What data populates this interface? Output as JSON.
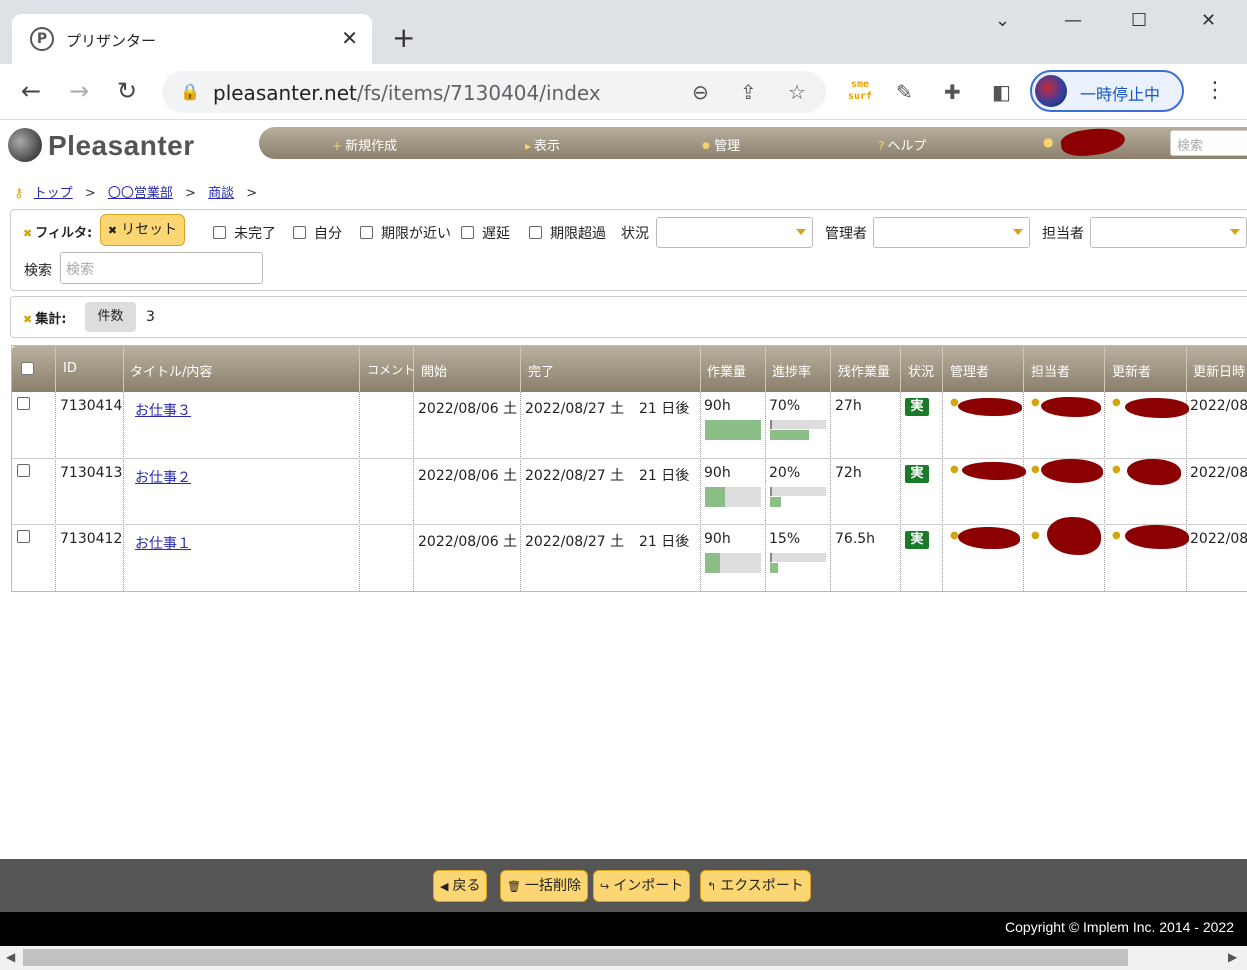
{
  "browser": {
    "tab_title": "プリザンター",
    "tab_favicon_letter": "P",
    "tab_close": "✕",
    "new_tab": "+",
    "url_host": "pleasanter.net",
    "url_path": "/fs/items/7130404/index",
    "profile_label": "一時停止中",
    "extension_label": "sme surf",
    "minimize": "—",
    "maximize": "☐",
    "close": "✕",
    "chevron": "⌄"
  },
  "app": {
    "logo": "Pleasanter",
    "menu": [
      {
        "icon": "+",
        "label": "新規作成"
      },
      {
        "icon": "▸",
        "label": "表示"
      },
      {
        "icon": "✹",
        "label": "管理"
      },
      {
        "icon": "?",
        "label": "ヘルプ"
      }
    ],
    "search_placeholder": "検索"
  },
  "breadcrumb": {
    "items": [
      "トップ",
      "〇〇営業部",
      "商談"
    ],
    "separator": ">"
  },
  "filter": {
    "label": "フィルタ:",
    "reset": "リセット",
    "checkboxes": [
      "未完了",
      "自分",
      "期限が近い",
      "遅延",
      "期限超過"
    ],
    "status_label": "状況",
    "manager_label": "管理者",
    "owner_label": "担当者",
    "search_label": "検索",
    "search_placeholder": "検索"
  },
  "summary": {
    "label": "集計:",
    "count_label": "件数",
    "count_value": "3"
  },
  "table": {
    "columns": [
      "ID",
      "タイトル/内容",
      "コメント",
      "開始",
      "完了",
      "作業量",
      "進捗率",
      "残作業量",
      "状況",
      "管理者",
      "担当者",
      "更新者",
      "更新日時"
    ],
    "rows": [
      {
        "id": "7130414",
        "title": "お仕事３",
        "start": "2022/08/06 土",
        "end": "2022/08/27 土",
        "due": "21 日後",
        "workload": "90h",
        "workload_fill": 1.0,
        "progress": "70%",
        "progress_fill": 0.7,
        "remaining": "27h",
        "status": "実",
        "updated": "2022/08"
      },
      {
        "id": "7130413",
        "title": "お仕事２",
        "start": "2022/08/06 土",
        "end": "2022/08/27 土",
        "due": "21 日後",
        "workload": "90h",
        "workload_fill": 0.35,
        "progress": "20%",
        "progress_fill": 0.2,
        "remaining": "72h",
        "status": "実",
        "updated": "2022/08"
      },
      {
        "id": "7130412",
        "title": "お仕事１",
        "start": "2022/08/06 土",
        "end": "2022/08/27 土",
        "due": "21 日後",
        "workload": "90h",
        "workload_fill": 0.27,
        "progress": "15%",
        "progress_fill": 0.15,
        "remaining": "76.5h",
        "status": "実",
        "updated": "2022/08"
      }
    ]
  },
  "footer": {
    "buttons": [
      {
        "icon": "◀",
        "label": "戻る"
      },
      {
        "icon": "🗑",
        "label": "一括削除"
      },
      {
        "icon": "↪",
        "label": "インポート"
      },
      {
        "icon": "↰",
        "label": "エクスポート"
      }
    ],
    "copyright": "Copyright © Implem Inc. 2014 - 2022"
  },
  "colors": {
    "menu_bar": "#9b917e",
    "button_yellow": "#fcd672",
    "status_green": "#1a7a2a",
    "redaction": "#8b0000",
    "progress_green": "#8cbf88"
  }
}
